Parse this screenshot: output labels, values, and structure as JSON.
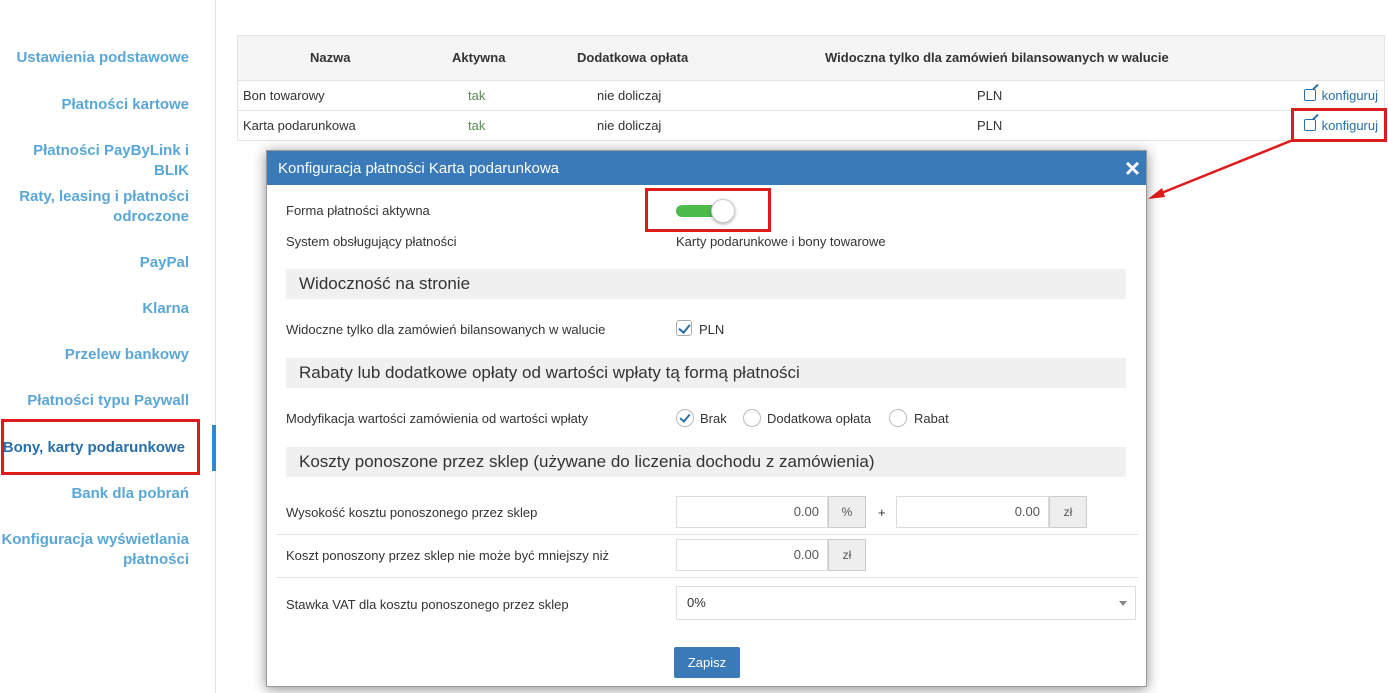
{
  "sidebar": {
    "items": [
      {
        "label": "Ustawienia podstawowe"
      },
      {
        "label": "Płatności kartowe"
      },
      {
        "label": "Płatności PayByLink i BLIK"
      },
      {
        "label": "Raty, leasing i płatności odroczone"
      },
      {
        "label": "PayPal"
      },
      {
        "label": "Klarna"
      },
      {
        "label": "Przelew bankowy"
      },
      {
        "label": "Płatności typu Paywall"
      },
      {
        "label": "Bony, karty podarunkowe"
      },
      {
        "label": "Bank dla pobrań"
      },
      {
        "label": "Konfiguracja wyświetlania płatności"
      }
    ],
    "active": "Bony, karty podarunkowe"
  },
  "table": {
    "columns": [
      "Nazwa",
      "Aktywna",
      "Dodatkowa opłata",
      "Widoczna tylko dla zamówień bilansowanych w walucie"
    ],
    "rows": [
      {
        "name": "Bon towarowy",
        "active": "tak",
        "fee": "nie doliczaj",
        "currency": "PLN",
        "action": "konfiguruj"
      },
      {
        "name": "Karta podarunkowa",
        "active": "tak",
        "fee": "nie doliczaj",
        "currency": "PLN",
        "action": "konfiguruj"
      }
    ]
  },
  "modal": {
    "title": "Konfiguracja płatności Karta podarunkowa",
    "close": "×",
    "active_label": "Forma płatności aktywna",
    "active_on": true,
    "system_label": "System obsługujący płatności",
    "system_value": "Karty podarunkowe i bony towarowe",
    "section_visibility": "Widoczność na stronie",
    "visibility_label": "Widoczne tylko dla zamówień bilansowanych w walucie",
    "visibility_currency": "PLN",
    "section_discounts": "Rabaty lub dodatkowe opłaty od wartości wpłaty tą formą płatności",
    "modification_label": "Modyfikacja wartości zamówienia od wartości wpłaty",
    "modification_options": [
      "Brak",
      "Dodatkowa opłata",
      "Rabat"
    ],
    "modification_selected": "Brak",
    "section_costs": "Koszty ponoszone przez sklep (używane do liczenia dochodu z zamówienia)",
    "cost_label": "Wysokość kosztu ponoszonego przez sklep",
    "cost_percent": "0.00",
    "cost_percent_unit": "%",
    "plus": "+",
    "cost_amount": "0.00",
    "cost_amount_unit": "zł",
    "min_cost_label": "Koszt ponoszony przez sklep nie może być mniejszy niż",
    "min_cost_value": "0.00",
    "min_cost_unit": "zł",
    "vat_label": "Stawka VAT dla kosztu ponoszonego przez sklep",
    "vat_value": "0%",
    "save_label": "Zapisz"
  },
  "colors": {
    "accent": "#3a7ab8",
    "sidebar_link": "#5aa7d6",
    "highlight": "#e01b1b",
    "toggle_on": "#4cbb4c"
  }
}
